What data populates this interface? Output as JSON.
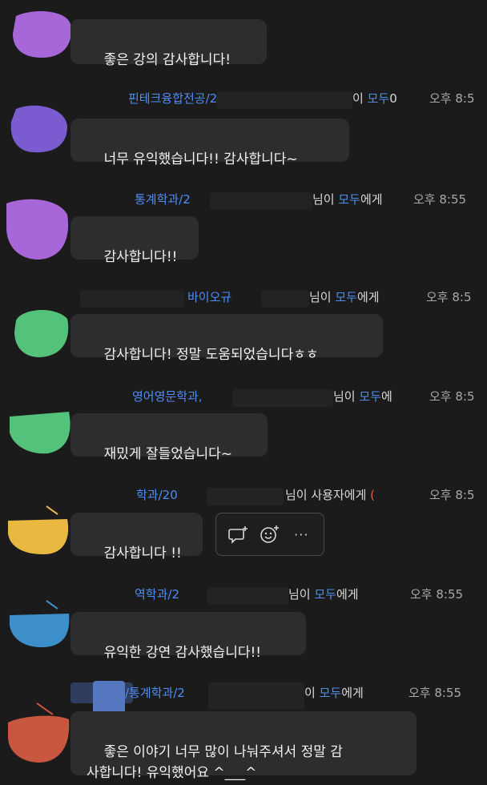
{
  "messages": [
    {
      "sender": "",
      "header_sep": "",
      "recipient": "",
      "recipient_suffix": "",
      "time": "",
      "text": "좋은 강의 감사합니다!"
    },
    {
      "sender": "핀테크융합전공/2",
      "header_sep": "이 ",
      "recipient": "모두",
      "recipient_suffix": "0",
      "time": "오후 8:5",
      "text": "너무 유익했습니다!! 감사합니다~"
    },
    {
      "sender": "통계학과/2",
      "header_sep": "님이 ",
      "recipient": "모두",
      "recipient_suffix": "에게",
      "time": "오후 8:55",
      "text": "감사합니다!!"
    },
    {
      "sender": "바이오규",
      "header_sep": "님이 ",
      "recipient": "모두",
      "recipient_suffix": "에게",
      "time": "오후 8:5",
      "text": "감사합니다! 정말 도움되었습니다ㅎㅎ"
    },
    {
      "sender": "영어영문학과,",
      "header_sep": "님이 ",
      "recipient": "모두",
      "recipient_suffix": "에",
      "time": "오후 8:5",
      "text": "재밌게 잘들었습니다~"
    },
    {
      "sender": "학과/20",
      "header_sep": "님이 사용자에게 ",
      "recipient": "(",
      "recipient_suffix": "",
      "time": "오후 8:5",
      "text": "감사합니다 !!"
    },
    {
      "sender": "역학과/2",
      "header_sep": "님이 ",
      "recipient": "모두",
      "recipient_suffix": "에게",
      "time": "오후 8:55",
      "text": "유익한 강연 감사했습니다!!"
    },
    {
      "sender": "/통계학과/2",
      "header_sep": "이 ",
      "recipient": "모두",
      "recipient_suffix": "에게",
      "time": "오후 8:55",
      "text": "좋은 이야기 너무 많이 나눠주셔서 정말 감\n사합니다! 유익했어요 ^___^"
    }
  ],
  "hover_actions": {
    "items": [
      "reply-thread-icon",
      "add-reaction-icon",
      "more-icon"
    ],
    "more_label": "···"
  },
  "colors": {
    "background": "#1b1b1c",
    "bubble": "#2d2d2f",
    "name": "#4e8df5",
    "private": "#e1604f",
    "time": "#a9a9a9"
  }
}
